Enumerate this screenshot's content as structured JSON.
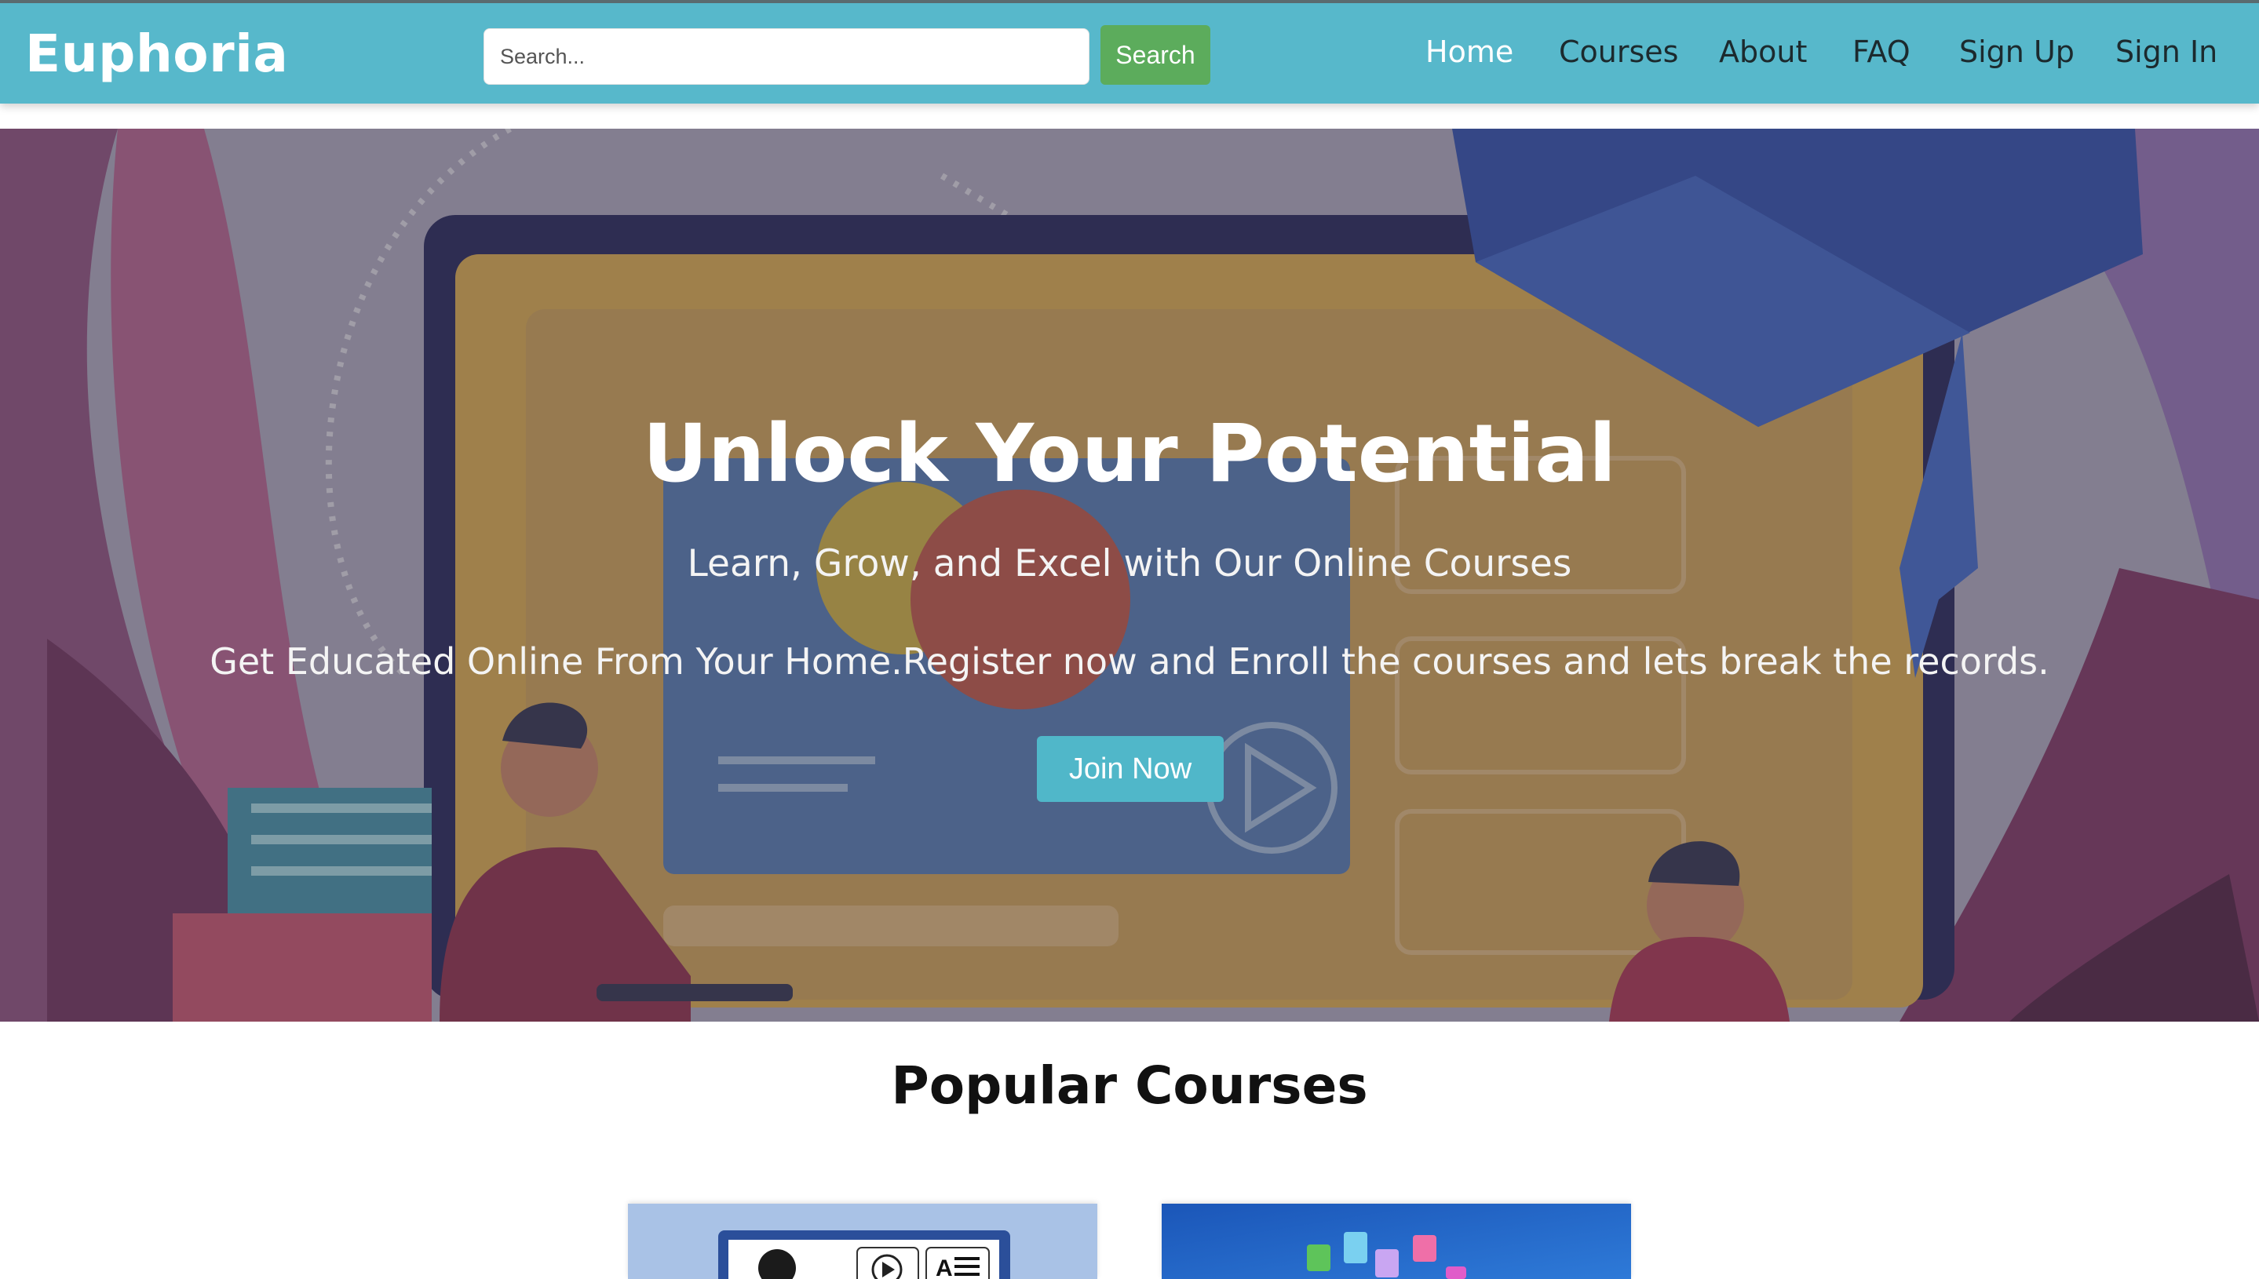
{
  "navbar": {
    "brand": "Euphoria",
    "search_placeholder": "Search...",
    "search_button": "Search",
    "links": [
      {
        "label": "Home",
        "active": true
      },
      {
        "label": "Courses",
        "active": false
      },
      {
        "label": "About",
        "active": false
      },
      {
        "label": "FAQ",
        "active": false
      },
      {
        "label": "Sign Up",
        "active": false
      },
      {
        "label": "Sign In",
        "active": false
      }
    ]
  },
  "hero": {
    "title": "Unlock Your Potential",
    "subtitle": "Learn, Grow, and Excel with Our Online Courses",
    "text": "Get Educated Online From Your Home.Register now and Enroll the courses and lets break the records.",
    "button": "Join Now"
  },
  "courses": {
    "title": "Popular Courses"
  },
  "colors": {
    "navbar_bg": "#57b8cb",
    "search_button_bg": "#5cac5c",
    "join_button_bg": "#50b7c9",
    "nav_link": "#1c2a2e",
    "nav_link_active": "#ffffff"
  },
  "icons": [
    "play-icon",
    "text-doc-icon",
    "app-icons"
  ]
}
